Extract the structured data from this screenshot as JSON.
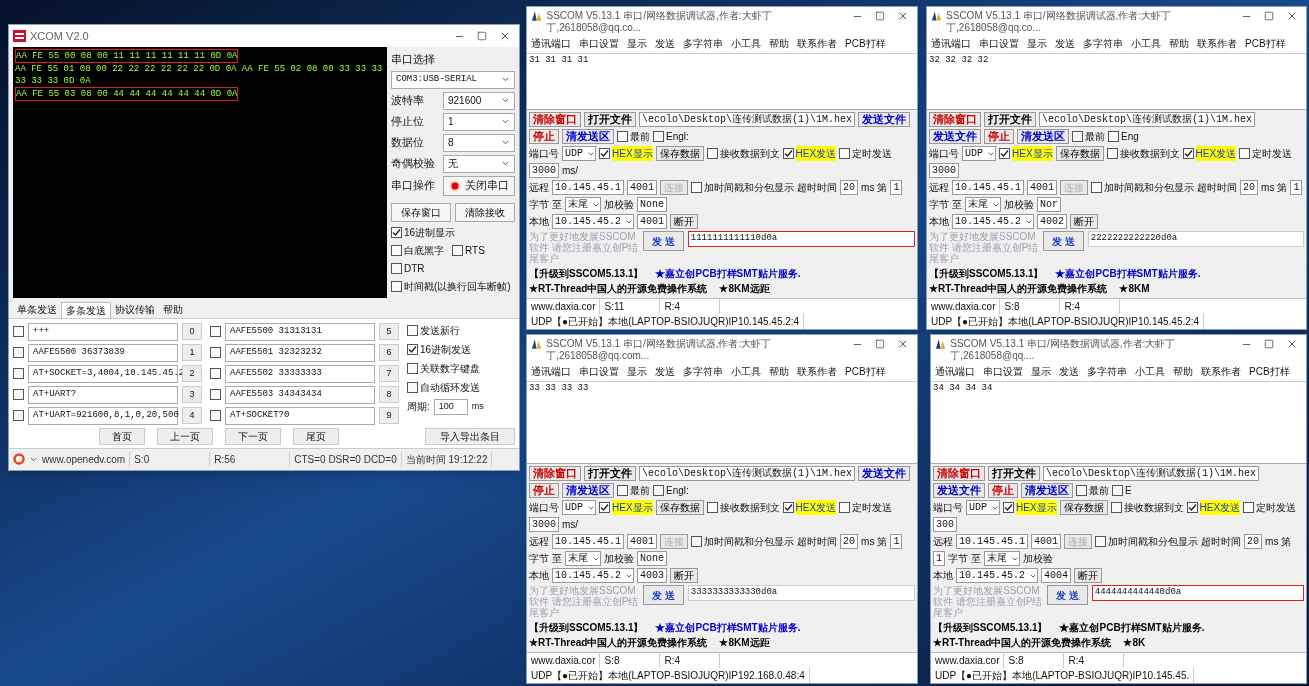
{
  "xcom": {
    "title": "XCOM V2.0",
    "receive": [
      {
        "text": "AA FE 55 00 08 00 11 11 11 11 11 11 0D 0A",
        "highlight": true
      },
      {
        "text": "AA FE 55 01 08 00 22 22 22 22 22 22 0D 0A AA FE 55 02 08 00 33 33 33 33 33 33 0D 0A",
        "highlight": false
      },
      {
        "text": "AA FE 55 03 08 00 44 44 44 44 44 44 0D 0A",
        "highlight": true
      }
    ],
    "port_label": "串口选择",
    "port": "COM3:USB-SERIAL",
    "settings": [
      {
        "label": "波特率",
        "value": "921600"
      },
      {
        "label": "停止位",
        "value": "1"
      },
      {
        "label": "数据位",
        "value": "8"
      },
      {
        "label": "奇偶校验",
        "value": "无"
      }
    ],
    "operation_label": "串口操作",
    "operation_button": "关闭串口",
    "buttons": [
      "保存窗口",
      "清除接收"
    ],
    "checks": [
      {
        "label": "16进制显示",
        "checked": true
      },
      {
        "label": "白底黑字",
        "checked": false
      },
      {
        "label": "RTS",
        "checked": false
      },
      {
        "label": "DTR",
        "checked": false
      },
      {
        "label": "时间戳(以换行回车断帧)",
        "checked": false
      }
    ],
    "tabs": [
      {
        "label": "单条发送",
        "selected": false
      },
      {
        "label": "多条发送",
        "selected": true
      },
      {
        "label": "协议传输",
        "selected": false
      },
      {
        "label": "帮助",
        "selected": false
      }
    ],
    "multi_send": [
      {
        "checked": false,
        "text": "+++",
        "index_label": "0"
      },
      {
        "checked": false,
        "text": "AAFE5500 36373839",
        "index_label": "1"
      },
      {
        "checked": false,
        "text": "AT+SOCKET=3,4004,10.145.45.2",
        "index_label": "2"
      },
      {
        "checked": false,
        "text": "AT+UART?",
        "index_label": "3"
      },
      {
        "checked": false,
        "text": "AT+UART=921600,8,1,0,20,500",
        "index_label": "4"
      },
      {
        "checked": false,
        "text": "AAFE5500 31313131",
        "index_label": "5"
      },
      {
        "checked": false,
        "text": "AAFE5501 32323232",
        "index_label": "6"
      },
      {
        "checked": false,
        "text": "AAFE5502 33333333",
        "index_label": "7"
      },
      {
        "checked": false,
        "text": "AAFE5503 34343434",
        "index_label": "8"
      },
      {
        "checked": false,
        "text": "AT+SOCKET?0",
        "index_label": "9"
      }
    ],
    "options": [
      {
        "label": "发送新行",
        "checked": false
      },
      {
        "label": "16进制发送",
        "checked": true
      },
      {
        "label": "关联数字键盘",
        "checked": false
      },
      {
        "label": "自动循环发送",
        "checked": false
      }
    ],
    "period_label": "周期:",
    "period": "100",
    "period_unit": "ms",
    "pager": [
      "首页",
      "上一页",
      "下一页",
      "尾页"
    ],
    "import_button": "导入导出条目",
    "status": [
      "www.openedv.com",
      "S:0",
      "R:56",
      "CTS=0 DSR=0 DCD=0",
      "当前时间 19:12:22"
    ]
  },
  "sscom_windows": [
    {
      "title": "SSCOM V5.13.1 串口/网络数据调试器,作者:大虾丁丁,2618058@qq.co...",
      "menu": [
        "通讯端口",
        "串口设置",
        "显示",
        "发送",
        "多字符串",
        "小工具",
        "帮助",
        "联系作者",
        "PCB打样"
      ],
      "receive": "31 31 31 31",
      "toolbar": [
        {
          "kind": "button",
          "label": "清除窗口",
          "color": "#cc0000"
        },
        {
          "kind": "button",
          "label": "打开文件",
          "color": "#000000"
        },
        {
          "kind": "field",
          "value": "\\ecolo\\Desktop\\连传测试数据(1)\\1M.hex"
        },
        {
          "kind": "button",
          "label": "发送文件",
          "color": "#0000cc"
        },
        {
          "kind": "button",
          "label": "停止",
          "color": "#cc0000"
        },
        {
          "kind": "button",
          "label": "清发送区",
          "color": "#0000cc"
        },
        {
          "kind": "check",
          "label": "最前",
          "checked": false,
          "highlighted": false
        },
        {
          "kind": "check",
          "label": "Engl:",
          "checked": false,
          "highlighted": false
        }
      ],
      "settings": [
        [
          {
            "kind": "label",
            "text": "端口号"
          },
          {
            "kind": "dropdown",
            "value": "UDP"
          },
          {
            "kind": "check",
            "label": "HEX显示",
            "checked": true,
            "highlighted": true
          },
          {
            "kind": "button",
            "label": "保存数据",
            "disabled": false
          },
          {
            "kind": "check",
            "label": "接收数据到文",
            "checked": false,
            "highlighted": false
          },
          {
            "kind": "check",
            "label": "HEX发送",
            "checked": true,
            "highlighted": true
          },
          {
            "kind": "check",
            "label": "定时发送",
            "checked": false,
            "highlighted": false
          },
          {
            "kind": "field",
            "value": "3000"
          },
          {
            "kind": "label",
            "text": "ms/"
          }
        ],
        [
          {
            "kind": "label",
            "text": "远程"
          },
          {
            "kind": "field",
            "value": "10.145.45.1"
          },
          {
            "kind": "field",
            "value": "4001"
          },
          {
            "kind": "button",
            "label": "连接",
            "disabled": true
          },
          {
            "kind": "check",
            "label": "加时间戳和分包显示",
            "checked": false,
            "highlighted": false
          },
          {
            "kind": "label",
            "text": "超时时间"
          },
          {
            "kind": "field",
            "value": "20"
          },
          {
            "kind": "label",
            "text": "ms"
          },
          {
            "kind": "label",
            "text": "第"
          },
          {
            "kind": "field",
            "value": "1"
          },
          {
            "kind": "label",
            "text": "字节"
          },
          {
            "kind": "label",
            "text": "至"
          },
          {
            "kind": "dropdown",
            "value": "末尾"
          },
          {
            "kind": "label",
            "text": "加校验"
          },
          {
            "kind": "field",
            "value": "None"
          }
        ],
        [
          {
            "kind": "label",
            "text": "本地"
          },
          {
            "kind": "dropdown",
            "value": "10.145.45.2"
          },
          {
            "kind": "field",
            "value": "4001"
          },
          {
            "kind": "button",
            "label": "断开",
            "disabled": false
          }
        ]
      ],
      "hint": "为了更好地发展SSCOM软件 请您注册嘉立创P结尾客户",
      "send_button": "发 送",
      "send": {
        "value": "1111111111110d0a",
        "highlighted": true
      },
      "promo": [
        {
          "text": "【升级到SSCOM5.13.1】",
          "color": "#000000"
        },
        {
          "text": "★嘉立创PCB打样SMT贴片服务.",
          "color": "#0000cc"
        },
        {
          "text": "★RT-Thread中国人的开源免费操作系统",
          "color": "#000000"
        },
        {
          "text": "★8KM远距",
          "color": "#000000"
        }
      ],
      "status": [
        "www.daxia.cor",
        "S:11",
        "R:4",
        "UDP【●已开始】本地(LAPTOP-BSIOJUQR)IP10.145.45.2:4"
      ]
    },
    {
      "title": "SSCOM V5.13.1 串口/网络数据调试器,作者:大虾丁丁,2618058@qq.co...",
      "menu": [
        "通讯端口",
        "串口设置",
        "显示",
        "发送",
        "多字符串",
        "小工具",
        "帮助",
        "联系作者",
        "PCB打样"
      ],
      "receive": "32 32 32 32",
      "toolbar": [
        {
          "kind": "button",
          "label": "清除窗口",
          "color": "#cc0000"
        },
        {
          "kind": "button",
          "label": "打开文件",
          "color": "#000000"
        },
        {
          "kind": "field",
          "value": "\\ecolo\\Desktop\\连传测试数据(1)\\1M.hex"
        },
        {
          "kind": "button",
          "label": "发送文件",
          "color": "#0000cc"
        },
        {
          "kind": "button",
          "label": "停止",
          "color": "#cc0000"
        },
        {
          "kind": "button",
          "label": "清发送区",
          "color": "#0000cc"
        },
        {
          "kind": "check",
          "label": "最前",
          "checked": false,
          "highlighted": false
        },
        {
          "kind": "check",
          "label": "Eng",
          "checked": false,
          "highlighted": false
        }
      ],
      "settings": [
        [
          {
            "kind": "label",
            "text": "端口号"
          },
          {
            "kind": "dropdown",
            "value": "UDP"
          },
          {
            "kind": "check",
            "label": "HEX显示",
            "checked": true,
            "highlighted": true
          },
          {
            "kind": "button",
            "label": "保存数据",
            "disabled": false
          },
          {
            "kind": "check",
            "label": "接收数据到文",
            "checked": false,
            "highlighted": false
          },
          {
            "kind": "check",
            "label": "HEX发送",
            "checked": true,
            "highlighted": true
          },
          {
            "kind": "check",
            "label": "定时发送",
            "checked": false,
            "highlighted": false
          },
          {
            "kind": "field",
            "value": "3000"
          }
        ],
        [
          {
            "kind": "label",
            "text": "远程"
          },
          {
            "kind": "field",
            "value": "10.145.45.1"
          },
          {
            "kind": "field",
            "value": "4001"
          },
          {
            "kind": "button",
            "label": "连接",
            "disabled": true
          },
          {
            "kind": "check",
            "label": "加时间戳和分包显示",
            "checked": false,
            "highlighted": false
          },
          {
            "kind": "label",
            "text": "超时时间"
          },
          {
            "kind": "field",
            "value": "20"
          },
          {
            "kind": "label",
            "text": "ms"
          },
          {
            "kind": "label",
            "text": "第"
          },
          {
            "kind": "field",
            "value": "1"
          },
          {
            "kind": "label",
            "text": "字节"
          },
          {
            "kind": "label",
            "text": "至"
          },
          {
            "kind": "dropdown",
            "value": "末尾"
          },
          {
            "kind": "label",
            "text": "加校验"
          },
          {
            "kind": "field",
            "value": "Nor"
          }
        ],
        [
          {
            "kind": "label",
            "text": "本地"
          },
          {
            "kind": "dropdown",
            "value": "10.145.45.2"
          },
          {
            "kind": "field",
            "value": "4002"
          },
          {
            "kind": "button",
            "label": "断开",
            "disabled": false
          }
        ]
      ],
      "hint": "为了更好地发展SSCOM软件 请您注册嘉立创P结尾客户",
      "send_button": "发 送",
      "send": {
        "value": "2222222222220d0a",
        "highlighted": false
      },
      "promo": [
        {
          "text": "【升级到SSCOM5.13.1】",
          "color": "#000000"
        },
        {
          "text": "★嘉立创PCB打样SMT贴片服务.",
          "color": "#0000cc"
        },
        {
          "text": "★RT-Thread中国人的开源免费操作系统",
          "color": "#000000"
        },
        {
          "text": "★8KM",
          "color": "#000000"
        }
      ],
      "status": [
        "www.daxia.cor",
        "S:8",
        "R:4",
        "UDP【●已开始】本地(LAPTOP-BSIOJUQR)IP10.145.45.2:4"
      ]
    },
    {
      "title": "SSCOM V5.13.1 串口/网络数据调试器,作者:大虾丁丁,2618058@qq.com...",
      "menu": [
        "通讯端口",
        "串口设置",
        "显示",
        "发送",
        "多字符串",
        "小工具",
        "帮助",
        "联系作者",
        "PCB打样"
      ],
      "receive": "33 33 33 33",
      "toolbar": [
        {
          "kind": "button",
          "label": "清除窗口",
          "color": "#cc0000"
        },
        {
          "kind": "button",
          "label": "打开文件",
          "color": "#000000"
        },
        {
          "kind": "field",
          "value": "\\ecolo\\Desktop\\连传测试数据(1)\\1M.hex"
        },
        {
          "kind": "button",
          "label": "发送文件",
          "color": "#0000cc"
        },
        {
          "kind": "button",
          "label": "停止",
          "color": "#cc0000"
        },
        {
          "kind": "button",
          "label": "清发送区",
          "color": "#0000cc"
        },
        {
          "kind": "check",
          "label": "最前",
          "checked": false,
          "highlighted": false
        },
        {
          "kind": "check",
          "label": "Engl:",
          "checked": false,
          "highlighted": false
        }
      ],
      "settings": [
        [
          {
            "kind": "label",
            "text": "端口号"
          },
          {
            "kind": "dropdown",
            "value": "UDP"
          },
          {
            "kind": "check",
            "label": "HEX显示",
            "checked": true,
            "highlighted": true
          },
          {
            "kind": "button",
            "label": "保存数据",
            "disabled": false
          },
          {
            "kind": "check",
            "label": "接收数据到文",
            "checked": false,
            "highlighted": false
          },
          {
            "kind": "check",
            "label": "HEX发送",
            "checked": true,
            "highlighted": true
          },
          {
            "kind": "check",
            "label": "定时发送",
            "checked": false,
            "highlighted": false
          },
          {
            "kind": "field",
            "value": "3000"
          },
          {
            "kind": "label",
            "text": "ms/"
          }
        ],
        [
          {
            "kind": "label",
            "text": "远程"
          },
          {
            "kind": "field",
            "value": "10.145.45.1"
          },
          {
            "kind": "field",
            "value": "4001"
          },
          {
            "kind": "button",
            "label": "连接",
            "disabled": true
          },
          {
            "kind": "check",
            "label": "加时间戳和分包显示",
            "checked": false,
            "highlighted": false
          },
          {
            "kind": "label",
            "text": "超时时间"
          },
          {
            "kind": "field",
            "value": "20"
          },
          {
            "kind": "label",
            "text": "ms"
          },
          {
            "kind": "label",
            "text": "第"
          },
          {
            "kind": "field",
            "value": "1"
          },
          {
            "kind": "label",
            "text": "字节"
          },
          {
            "kind": "label",
            "text": "至"
          },
          {
            "kind": "dropdown",
            "value": "末尾"
          },
          {
            "kind": "label",
            "text": "加校验"
          },
          {
            "kind": "field",
            "value": "None"
          }
        ],
        [
          {
            "kind": "label",
            "text": "本地"
          },
          {
            "kind": "dropdown",
            "value": "10.145.45.2"
          },
          {
            "kind": "field",
            "value": "4003"
          },
          {
            "kind": "button",
            "label": "断开",
            "disabled": false
          }
        ]
      ],
      "hint": "为了更好地发展SSCOM软件 请您注册嘉立创P结尾客户",
      "send_button": "发 送",
      "send": {
        "value": "3333333333330d0a",
        "highlighted": false
      },
      "promo": [
        {
          "text": "【升级到SSCOM5.13.1】",
          "color": "#000000"
        },
        {
          "text": "★嘉立创PCB打样SMT贴片服务.",
          "color": "#0000cc"
        },
        {
          "text": "★RT-Thread中国人的开源免费操作系统",
          "color": "#000000"
        },
        {
          "text": "★8KM远距",
          "color": "#000000"
        }
      ],
      "status": [
        "www.daxia.cor",
        "S:8",
        "R:4",
        "UDP【●已开始】本地(LAPTOP-BSIOJUQR)IP192.168.0.48:4"
      ]
    },
    {
      "title": "SSCOM V5.13.1 串口/网络数据调试器,作者:大虾丁丁,2618058@qq....",
      "menu": [
        "通讯端口",
        "串口设置",
        "显示",
        "发送",
        "多字符串",
        "小工具",
        "帮助",
        "联系作者",
        "PCB打样"
      ],
      "receive": "34 34 34 34",
      "toolbar": [
        {
          "kind": "button",
          "label": "清除窗口",
          "color": "#cc0000"
        },
        {
          "kind": "button",
          "label": "打开文件",
          "color": "#000000"
        },
        {
          "kind": "field",
          "value": "\\ecolo\\Desktop\\连传测试数据(1)\\1M.hex"
        },
        {
          "kind": "button",
          "label": "发送文件",
          "color": "#0000cc"
        },
        {
          "kind": "button",
          "label": "停止",
          "color": "#cc0000"
        },
        {
          "kind": "button",
          "label": "清发送区",
          "color": "#0000cc"
        },
        {
          "kind": "check",
          "label": "最前",
          "checked": false,
          "highlighted": false
        },
        {
          "kind": "check",
          "label": "E",
          "checked": false,
          "highlighted": false
        }
      ],
      "settings": [
        [
          {
            "kind": "label",
            "text": "端口号"
          },
          {
            "kind": "dropdown",
            "value": "UDP"
          },
          {
            "kind": "check",
            "label": "HEX显示",
            "checked": true,
            "highlighted": true
          },
          {
            "kind": "button",
            "label": "保存数据",
            "disabled": false
          },
          {
            "kind": "check",
            "label": "接收数据到文",
            "checked": false,
            "highlighted": false
          },
          {
            "kind": "check",
            "label": "HEX发送",
            "checked": true,
            "highlighted": true
          },
          {
            "kind": "check",
            "label": "定时发送",
            "checked": false,
            "highlighted": false
          },
          {
            "kind": "field",
            "value": "300"
          }
        ],
        [
          {
            "kind": "label",
            "text": "远程"
          },
          {
            "kind": "field",
            "value": "10.145.45.1"
          },
          {
            "kind": "field",
            "value": "4001"
          },
          {
            "kind": "button",
            "label": "连接",
            "disabled": true
          },
          {
            "kind": "check",
            "label": "加时间戳和分包显示",
            "checked": false,
            "highlighted": false
          },
          {
            "kind": "label",
            "text": "超时时间"
          },
          {
            "kind": "field",
            "value": "20"
          },
          {
            "kind": "label",
            "text": "ms"
          },
          {
            "kind": "label",
            "text": "第"
          },
          {
            "kind": "field",
            "value": "1"
          },
          {
            "kind": "label",
            "text": "字节"
          },
          {
            "kind": "label",
            "text": "至"
          },
          {
            "kind": "dropdown",
            "value": "末尾"
          },
          {
            "kind": "label",
            "text": "加校验"
          }
        ],
        [
          {
            "kind": "label",
            "text": "本地"
          },
          {
            "kind": "dropdown",
            "value": "10.145.45.2"
          },
          {
            "kind": "field",
            "value": "4004"
          },
          {
            "kind": "button",
            "label": "断开",
            "disabled": false
          }
        ]
      ],
      "hint": "为了更好地发展SSCOM软件 请您注册嘉立创P结尾客户",
      "send_button": "发 送",
      "send": {
        "value": "4444444444440d0a",
        "highlighted": true
      },
      "promo": [
        {
          "text": "【升级到SSCOM5.13.1】",
          "color": "#000000"
        },
        {
          "text": "★嘉立创PCB打样SMT贴片服务.",
          "color": "#000000"
        },
        {
          "text": "★RT-Thread中国人的开源免费操作系统",
          "color": "#000000"
        },
        {
          "text": "★8K",
          "color": "#000000"
        }
      ],
      "status": [
        "www.daxia.cor",
        "S:8",
        "R:4",
        "UDP【●已开始】本地(LAPTOP-BSIOJUQR)IP10.145.45."
      ]
    }
  ]
}
